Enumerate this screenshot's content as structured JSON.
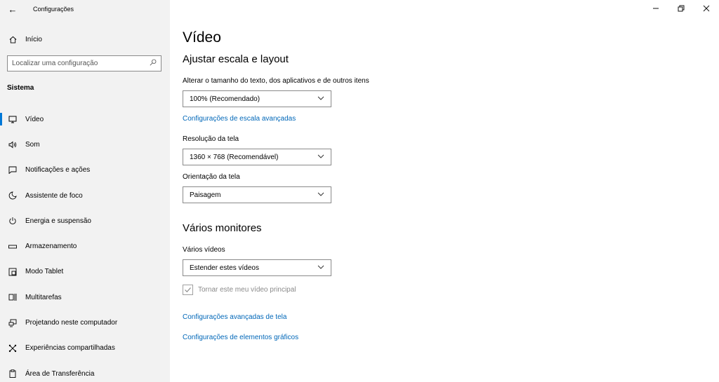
{
  "window": {
    "title": "Configurações",
    "back_icon": "arrow-left-icon",
    "controls": [
      "minimize-icon",
      "restore-icon",
      "close-icon"
    ]
  },
  "sidebar": {
    "home_label": "Início",
    "search_placeholder": "Localizar uma configuração",
    "section": "Sistema",
    "items": [
      {
        "label": "Vídeo",
        "icon": "monitor-icon",
        "active": true
      },
      {
        "label": "Som",
        "icon": "speaker-icon"
      },
      {
        "label": "Notificações e ações",
        "icon": "notification-icon"
      },
      {
        "label": "Assistente de foco",
        "icon": "moon-icon"
      },
      {
        "label": "Energia e suspensão",
        "icon": "power-icon"
      },
      {
        "label": "Armazenamento",
        "icon": "storage-icon"
      },
      {
        "label": "Modo Tablet",
        "icon": "tablet-icon"
      },
      {
        "label": "Multitarefas",
        "icon": "multitask-icon"
      },
      {
        "label": "Projetando neste computador",
        "icon": "projector-icon"
      },
      {
        "label": "Experiências compartilhadas",
        "icon": "share-icon"
      },
      {
        "label": "Área de Transferência",
        "icon": "clipboard-icon"
      }
    ]
  },
  "main": {
    "title": "Vídeo",
    "scale_section": "Ajustar escala e layout",
    "scale_label": "Alterar o tamanho do texto, dos aplicativos e de outros itens",
    "scale_value": "100% (Recomendado)",
    "scale_link": "Configurações de escala avançadas",
    "resolution_label": "Resolução da tela",
    "resolution_value": "1360 × 768 (Recomendável)",
    "orientation_label": "Orientação da tela",
    "orientation_value": "Paisagem",
    "monitors_section": "Vários monitores",
    "monitors_label": "Vários vídeos",
    "monitors_value": "Estender estes vídeos",
    "main_display_label": "Tornar este meu vídeo principal",
    "main_display_checked": true,
    "advanced_link": "Configurações avançadas de tela",
    "graphics_link": "Configurações de elementos gráficos"
  }
}
